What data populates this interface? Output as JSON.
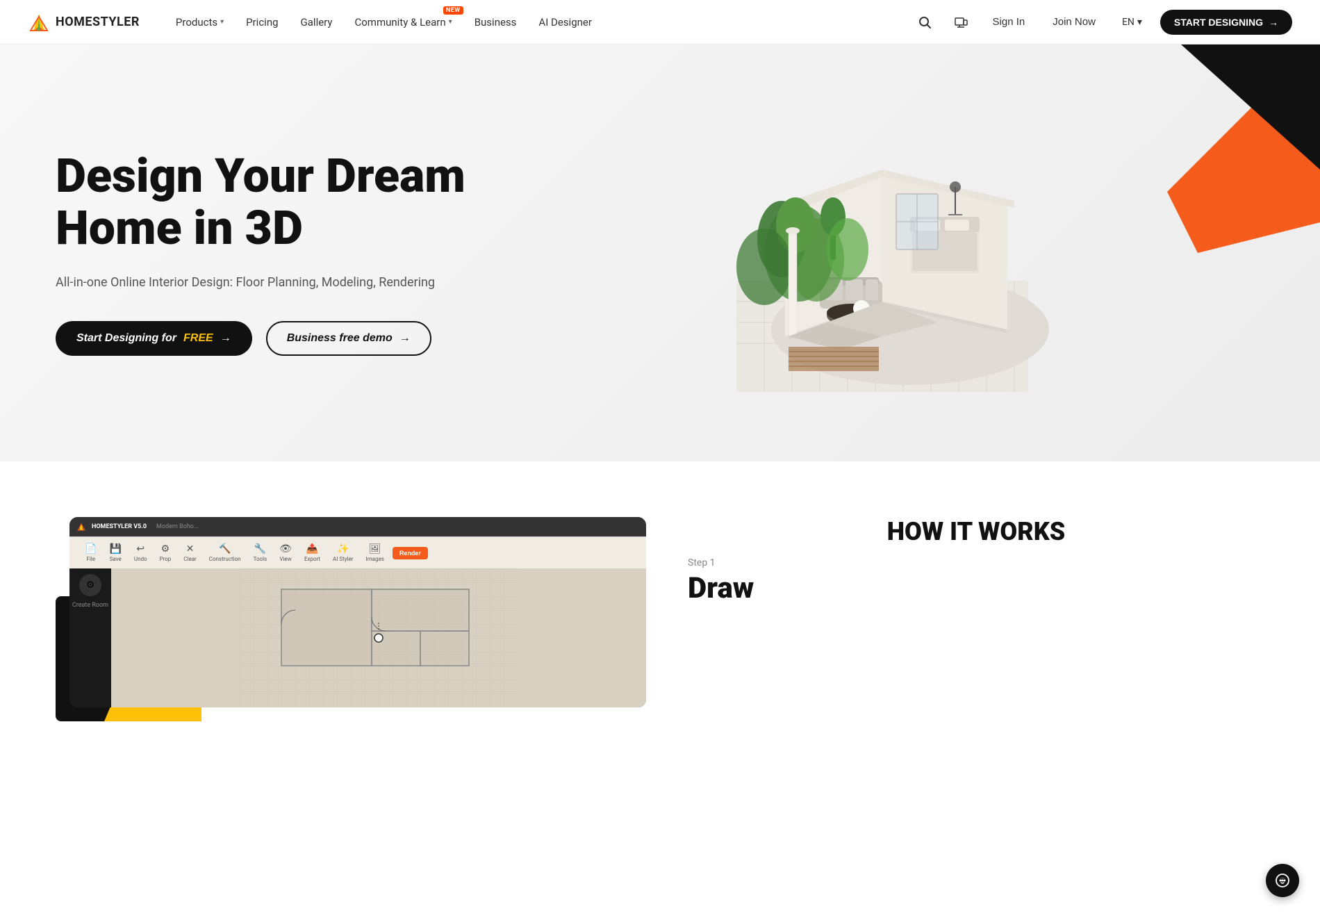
{
  "nav": {
    "logo_text": "HOMESTYLER",
    "links": [
      {
        "label": "Products",
        "has_dropdown": true
      },
      {
        "label": "Pricing",
        "has_dropdown": false
      },
      {
        "label": "Gallery",
        "has_dropdown": false
      },
      {
        "label": "Community & Learn",
        "has_dropdown": true,
        "badge": "NEW"
      },
      {
        "label": "Business",
        "has_dropdown": false
      },
      {
        "label": "AI Designer",
        "has_dropdown": false
      }
    ],
    "sign_in": "Sign In",
    "join_now": "Join Now",
    "lang": "EN",
    "start_designing": "START DESIGNING"
  },
  "hero": {
    "title_line1": "Design Your Dream",
    "title_line2": "Home in 3D",
    "subtitle": "All-in-one Online Interior Design: Floor Planning, Modeling, Rendering",
    "btn_primary_prefix": "Start Designing for ",
    "btn_primary_free": "FREE",
    "btn_primary_arrow": "→",
    "btn_secondary": "Business free demo",
    "btn_secondary_arrow": "→"
  },
  "how_it_works": {
    "section_title": "HOW IT WORKS",
    "step_number": "Step 1",
    "step_title": "Draw"
  },
  "app_toolbar": {
    "app_name": "HOMESTYLER V5.0",
    "project_name": "Modern Boho...",
    "tools": [
      "File",
      "Save",
      "Undo",
      "Prop",
      "Clear",
      "Construction",
      "Tools",
      "View",
      "Export",
      "AI Styler",
      "Images",
      "Render"
    ],
    "clear_label": "Clear"
  },
  "sidebar": {
    "create_room": "Create Room"
  },
  "chat_icon": "💬",
  "colors": {
    "black": "#111111",
    "orange": "#f55c1b",
    "yellow": "#ffc107",
    "accent": "#f55c1b"
  }
}
